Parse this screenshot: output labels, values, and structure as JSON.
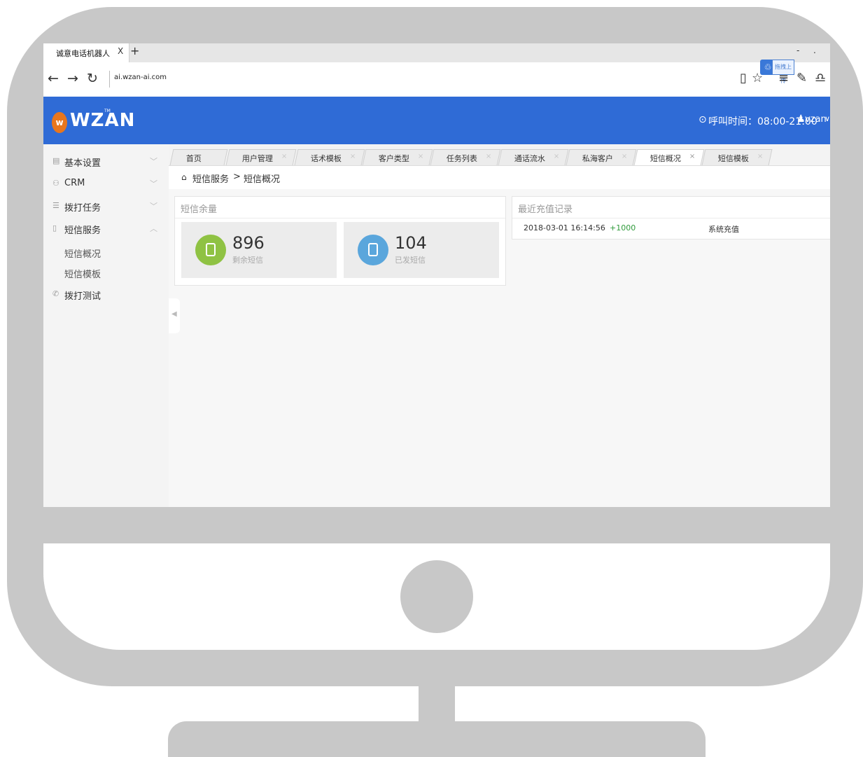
{
  "browser": {
    "tab_title": "诚意电话机器人",
    "tab_close": "X",
    "new_tab": "+",
    "url": "ai.wzan-ai.com",
    "minimize": "-",
    "maximize": ".",
    "extension_label": "拖拽上传"
  },
  "header": {
    "logo_text": "WZAN",
    "logo_tm": "TM",
    "call_time": "呼叫时间：08:00-21:00",
    "username": "vzan",
    "brand_color": "#2f6bd6"
  },
  "sidebar": {
    "items": [
      {
        "label": "基本设置",
        "icon": "settings-icon",
        "chevron": "﹀"
      },
      {
        "label": "CRM",
        "icon": "users-icon",
        "chevron": "﹀"
      },
      {
        "label": "拨打任务",
        "icon": "list-icon",
        "chevron": "﹀"
      },
      {
        "label": "短信服务",
        "icon": "phone-icon",
        "chevron": "︿"
      }
    ],
    "sub_items": [
      "短信概况",
      "短信模板"
    ],
    "extra_item": {
      "label": "拨打测试",
      "icon": "call-icon"
    }
  },
  "tabs": [
    {
      "label": "首页"
    },
    {
      "label": "用户管理"
    },
    {
      "label": "话术模板"
    },
    {
      "label": "客户类型"
    },
    {
      "label": "任务列表"
    },
    {
      "label": "通话流水"
    },
    {
      "label": "私海客户"
    },
    {
      "label": "短信概况",
      "active": true
    },
    {
      "label": "短信模板"
    }
  ],
  "tab_close_glyph": "×",
  "breadcrumb": {
    "parent": "短信服务",
    "sep": ">",
    "current": "短信概况"
  },
  "sms_balance": {
    "title": "短信余量",
    "remaining": {
      "value": "896",
      "label": "剩余短信",
      "color": "#8fc243"
    },
    "sent": {
      "value": "104",
      "label": "已发短信",
      "color": "#5aa6dc"
    }
  },
  "recharge": {
    "title": "最近充值记录",
    "records": [
      {
        "time": "2018-03-01 16:14:56",
        "amount": "+1000",
        "type": "系统充值"
      }
    ]
  }
}
